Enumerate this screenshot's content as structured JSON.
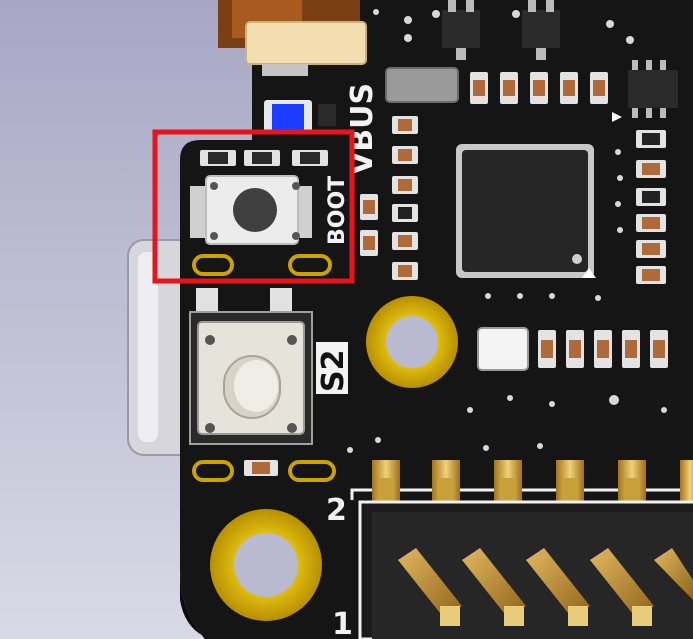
{
  "labels": {
    "boot": "BOOT",
    "s2": "S2",
    "vbus": "VBUS",
    "pin2": "2",
    "pin1": "1"
  },
  "highlight": {
    "color": "#e8141b",
    "target": "BOOT button"
  },
  "colors": {
    "background": "#b8b8d0",
    "board": "#151515",
    "gold": "#c9a300",
    "silkscreen": "#f2f2f2",
    "led_blue": "#1a3cff"
  }
}
